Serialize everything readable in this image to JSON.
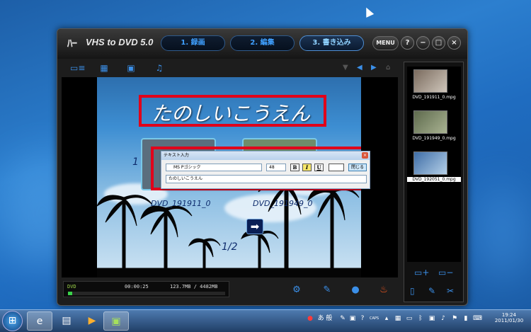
{
  "app": {
    "title": "VHS to DVD 5.0",
    "steps": [
      {
        "label": "1. 録画",
        "active": false
      },
      {
        "label": "2. 編集",
        "active": false
      },
      {
        "label": "3. 書き込み",
        "active": true
      }
    ],
    "menu_label": "MENU",
    "help_label": "?",
    "minimize_label": "−",
    "maximize_label": "□",
    "close_label": "×"
  },
  "toolbar": {
    "icons": [
      "layout-list-icon",
      "grid-layout-icon",
      "image-icon",
      "music-note-icon"
    ],
    "nav_icons": [
      "triangle-down-icon",
      "arrow-left-icon",
      "arrow-right-icon",
      "home-icon"
    ]
  },
  "menu_preview": {
    "title_text": "たのしいこうえん",
    "clips": [
      {
        "label": "DVD_191911_0"
      },
      {
        "label": "DVD_191949_0"
      }
    ],
    "index_number": "1",
    "page": "1/2",
    "next_glyph": "➡"
  },
  "text_dialog": {
    "title": "テキスト入力",
    "close_glyph": "×",
    "font": "MS Pゴシック",
    "size": "48",
    "bold": "B",
    "italic": "I",
    "underline": "U",
    "close_button": "閉じる",
    "text_value": "たのしいこうえん"
  },
  "status": {
    "disc": "DVD",
    "duration": "00:00:25",
    "capacity": "123.7MB / 4482MB",
    "capacity_fraction": 0.028
  },
  "clip_list": [
    {
      "name": "DVD_191911_0.mpg",
      "selected": false
    },
    {
      "name": "DVD_191949_0.mpg",
      "selected": false
    },
    {
      "name": "DVD_192051_0.mpg",
      "selected": true
    }
  ],
  "taskbar": {
    "apps": [
      "internet-explorer-icon",
      "file-explorer-icon",
      "media-player-icon",
      "vhs-to-dvd-icon"
    ],
    "clock_time": "19:24",
    "clock_date": "2011/01/30",
    "ime_text": "あ 般"
  },
  "colors": {
    "accent": "#3b8fe8",
    "highlight_border": "#e1001a",
    "capacity_bar": "#3bd24a"
  }
}
